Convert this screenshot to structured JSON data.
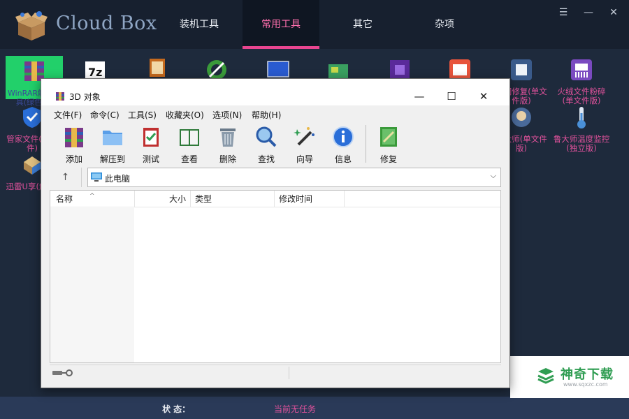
{
  "app": {
    "title": "Cloud Box",
    "tabs": [
      {
        "label": "装机工具",
        "active": false
      },
      {
        "label": "常用工具",
        "active": true
      },
      {
        "label": "其它",
        "active": false
      },
      {
        "label": "杂项",
        "active": false
      }
    ],
    "window_controls": {
      "menu_icon": "menu-icon",
      "minimize_icon": "minimize-icon",
      "close_icon": "close-icon"
    },
    "tool_items": [
      {
        "label": "WinRAR解压工具(绿色版)",
        "icon": "winrar-icon",
        "color": "#7a3a8a"
      },
      {
        "label": "7z",
        "icon": "7zip-icon",
        "color": "#ffffff"
      },
      {
        "label": "",
        "icon": "archive-icon",
        "color": "#c56a1e"
      },
      {
        "label": "",
        "icon": "browser-icon",
        "color": "#3a9a3a"
      },
      {
        "label": "",
        "icon": "monitor-icon",
        "color": "#2a5bd0"
      },
      {
        "label": "",
        "icon": "card-icon",
        "color": "#3aa060"
      },
      {
        "label": "",
        "icon": "cpu-icon",
        "color": "#5a2a9a"
      },
      {
        "label": "",
        "icon": "window-icon",
        "color": "#e8543c"
      },
      {
        "label": "断网修复(单文件版)",
        "icon": "network-repair-icon",
        "color": "#3a5a8a"
      },
      {
        "label": "火绒文件粉碎(单文件版)",
        "icon": "shredder-icon",
        "color": "#7a4ac0"
      },
      {
        "label": "管家文件(单文件)",
        "icon": "shield-icon",
        "color": "#2a6ed8"
      },
      {
        "label": "鲁大师(单文件版)",
        "icon": "master-lu-icon",
        "color": "#4a6a9a"
      },
      {
        "label": "鲁大师温度监控(独立版)",
        "icon": "thermometer-icon",
        "color": "#4a90d8"
      },
      {
        "label": "迅雷U享(解版)",
        "icon": "thunder-icon",
        "color": "#3a7ad0"
      }
    ],
    "status": {
      "label": "状 态：",
      "value": "当前无任务"
    }
  },
  "winrar": {
    "title": "3D 对象",
    "controls": {
      "minimize": "—",
      "maximize": "☐",
      "close": "✕"
    },
    "menu": [
      "文件(F)",
      "命令(C)",
      "工具(S)",
      "收藏夹(O)",
      "选项(N)",
      "帮助(H)"
    ],
    "toolbar": [
      {
        "label": "添加",
        "icon": "add-archive-icon"
      },
      {
        "label": "解压到",
        "icon": "extract-folder-icon"
      },
      {
        "label": "测试",
        "icon": "test-icon"
      },
      {
        "label": "查看",
        "icon": "view-book-icon"
      },
      {
        "label": "删除",
        "icon": "delete-bin-icon"
      },
      {
        "label": "查找",
        "icon": "find-magnifier-icon"
      },
      {
        "label": "向导",
        "icon": "wizard-wand-icon"
      },
      {
        "label": "信息",
        "icon": "info-icon"
      },
      {
        "label": "修复",
        "icon": "repair-icon"
      }
    ],
    "address": {
      "text": "此电脑",
      "up_icon": "up-arrow-icon"
    },
    "columns": [
      "名称",
      "大小",
      "类型",
      "修改时间"
    ]
  },
  "watermark": {
    "text": "神奇下载",
    "url": "www.sqxzc.com"
  }
}
